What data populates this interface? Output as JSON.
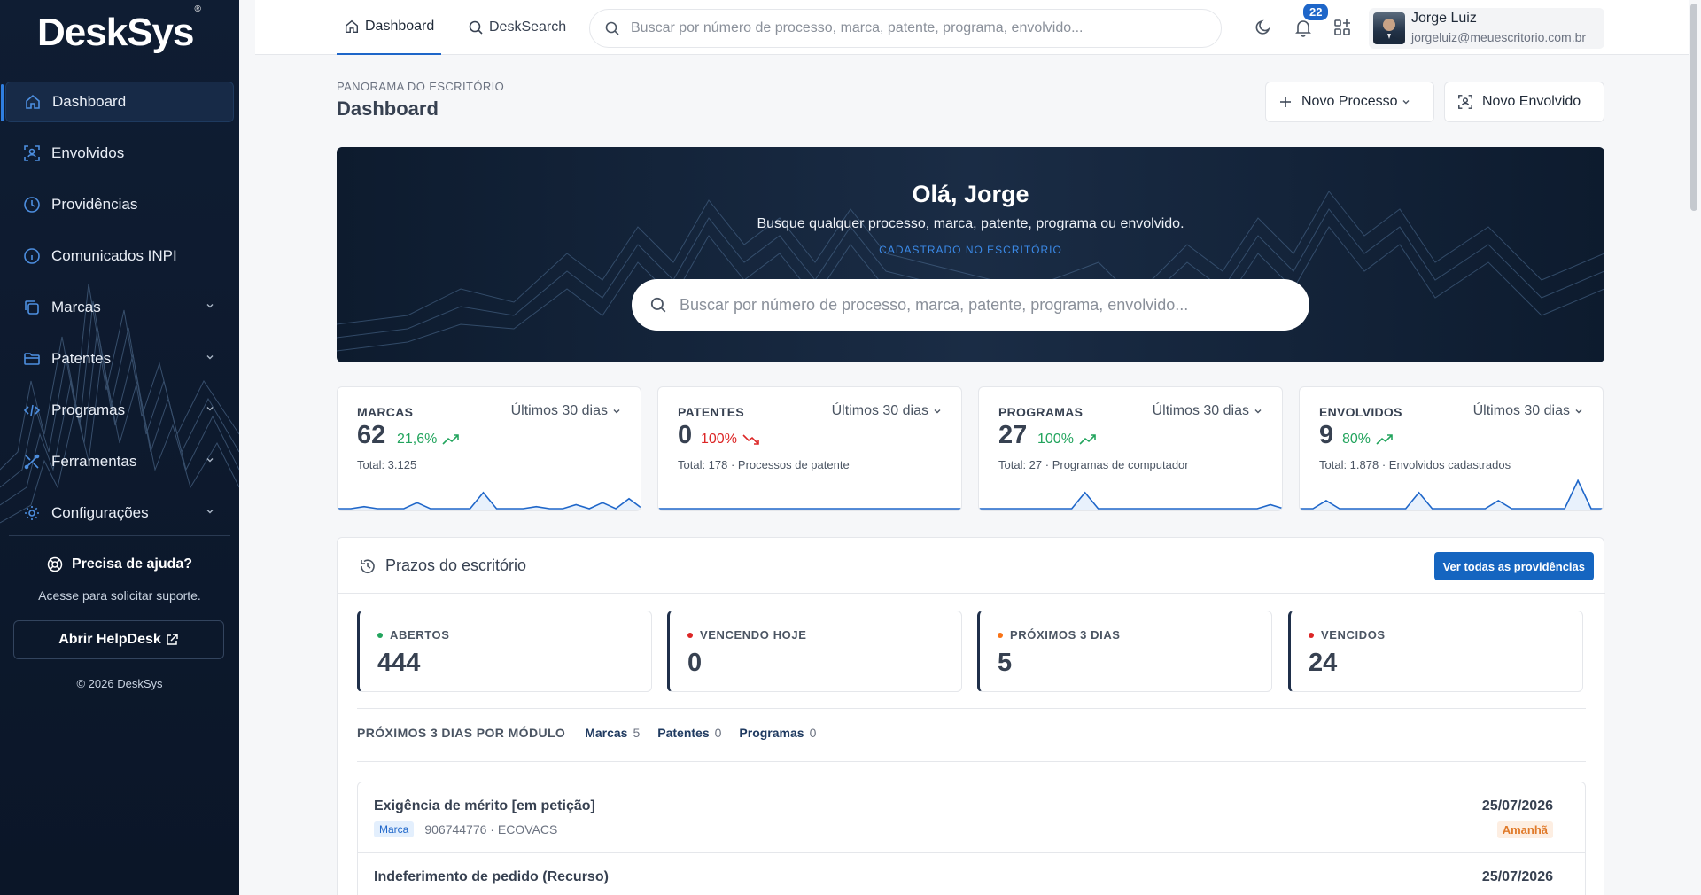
{
  "brand": {
    "name": "DeskSys",
    "registered": "®"
  },
  "sidebar": {
    "items": [
      {
        "label": "Dashboard",
        "icon": "home-icon"
      },
      {
        "label": "Envolvidos",
        "icon": "users-icon"
      },
      {
        "label": "Providências",
        "icon": "clock-icon"
      },
      {
        "label": "Comunicados INPI",
        "icon": "info-icon"
      },
      {
        "label": "Marcas",
        "icon": "copy-icon"
      },
      {
        "label": "Patentes",
        "icon": "folder-icon"
      },
      {
        "label": "Programas",
        "icon": "code-icon"
      },
      {
        "label": "Ferramentas",
        "icon": "tools-icon"
      },
      {
        "label": "Configurações",
        "icon": "gear-icon"
      }
    ],
    "help": {
      "title": "Precisa de ajuda?",
      "subtitle": "Acesse para solicitar suporte.",
      "button": "Abrir HelpDesk",
      "copyright": "© 2026 DeskSys"
    }
  },
  "topbar": {
    "tabs": [
      {
        "label": "Dashboard"
      },
      {
        "label": "DeskSearch"
      }
    ],
    "search_placeholder": "Buscar por número de processo, marca, patente, programa, envolvido...",
    "notifications_count": "22",
    "user": {
      "name": "Jorge Luiz",
      "email": "jorgeluiz@meuescritorio.com.br"
    }
  },
  "header": {
    "eyebrow": "PANORAMA DO ESCRITÓRIO",
    "title": "Dashboard",
    "new_process": "Novo Processo",
    "new_envolvido": "Novo Envolvido"
  },
  "hero": {
    "title": "Olá, Jorge",
    "subtitle": "Busque qualquer processo, marca, patente, programa ou envolvido.",
    "tag": "CADASTRADO NO ESCRITÓRIO",
    "search_placeholder": "Buscar por número de processo, marca, patente, programa, envolvido..."
  },
  "stats": [
    {
      "label": "MARCAS",
      "period": "Últimos 30 dias",
      "value": "62",
      "delta": "21,6%",
      "trend": "up",
      "total": "Total: 3.125",
      "spark": [
        0,
        0,
        1,
        0,
        0,
        0,
        3,
        0,
        0,
        0,
        0,
        8,
        0,
        0,
        0,
        1,
        0,
        0,
        2,
        0,
        3,
        0,
        5,
        0
      ]
    },
    {
      "label": "PATENTES",
      "period": "Últimos 30 dias",
      "value": "0",
      "delta": "100%",
      "trend": "down",
      "total": "Total: 178 · Processos de patente",
      "spark": [
        0,
        0,
        0,
        0,
        0,
        0,
        0,
        0,
        0,
        0,
        0,
        0,
        0,
        0,
        0,
        0,
        0,
        0,
        0,
        0,
        0,
        0,
        0,
        0
      ]
    },
    {
      "label": "PROGRAMAS",
      "period": "Últimos 30 dias",
      "value": "27",
      "delta": "100%",
      "trend": "up",
      "total": "Total: 27 · Programas de computador",
      "spark": [
        0,
        0,
        0,
        0,
        0,
        0,
        0,
        0,
        8,
        0,
        0,
        0,
        0,
        0,
        0,
        0,
        0,
        0,
        0,
        0,
        0,
        0,
        2,
        0
      ]
    },
    {
      "label": "ENVOLVIDOS",
      "period": "Últimos 30 dias",
      "value": "9",
      "delta": "80%",
      "trend": "up",
      "total": "Total: 1.878 · Envolvidos cadastrados",
      "spark": [
        0,
        0,
        4,
        0,
        0,
        0,
        0,
        0,
        0,
        8,
        0,
        0,
        0,
        0,
        0,
        4,
        0,
        0,
        0,
        0,
        0,
        14,
        0,
        0
      ]
    }
  ],
  "prazos": {
    "title": "Prazos do escritório",
    "button": "Ver todas as providências",
    "kpis": [
      {
        "label": "ABERTOS",
        "value": "444",
        "color": "#22a45d"
      },
      {
        "label": "VENCENDO HOJE",
        "value": "0",
        "color": "#dc2626"
      },
      {
        "label": "PRÓXIMOS 3 DIAS",
        "value": "5",
        "color": "#f97316"
      },
      {
        "label": "VENCIDOS",
        "value": "24",
        "color": "#dc2626"
      }
    ],
    "modules_label": "PRÓXIMOS 3 DIAS POR MÓDULO",
    "modules": [
      {
        "name": "Marcas",
        "count": "5"
      },
      {
        "name": "Patentes",
        "count": "0"
      },
      {
        "name": "Programas",
        "count": "0"
      }
    ],
    "deadlines": [
      {
        "title": "Exigência de mérito [em petição]",
        "tag": "Marca",
        "meta": "906744776 · ECOVACS",
        "date": "25/07/2026",
        "badge": "Amanhã"
      },
      {
        "title": "Indeferimento de pedido (Recurso)",
        "tag": "",
        "meta": "",
        "date": "25/07/2026",
        "badge": ""
      }
    ]
  }
}
